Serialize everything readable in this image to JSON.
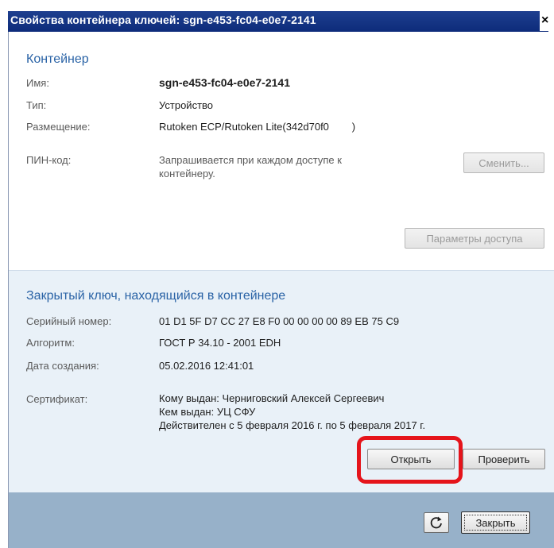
{
  "window": {
    "title": "Свойства контейнера ключей: sgn-e453-fc04-e0e7-2141",
    "close_glyph": "×"
  },
  "container": {
    "heading": "Контейнер",
    "name_label": "Имя:",
    "name_value": "sgn-e453-fc04-e0e7-2141",
    "type_label": "Тип:",
    "type_value": "Устройство",
    "placement_label": "Размещение:",
    "placement_value": "Rutoken ECP/Rutoken Lite(342d70f0        )",
    "pin_label": "ПИН-код:",
    "pin_value_line1": "Запрашивается при каждом доступе к",
    "pin_value_line2": "контейнеру.",
    "change_button": "Сменить...",
    "access_params_button": "Параметры доступа"
  },
  "private_key": {
    "heading": "Закрытый ключ, находящийся в контейнере",
    "serial_label": "Серийный номер:",
    "serial_value": "01 D1 5F D7 CC 27 E8 F0 00 00 00 00 89 EB 75 C9",
    "algorithm_label": "Алгоритм:",
    "algorithm_value": "ГОСТ Р 34.10 - 2001 EDH",
    "created_label": "Дата создания:",
    "created_value": "05.02.2016 12:41:01",
    "certificate_label": "Сертификат:",
    "issued_to": "Кому выдан: Черниговский Алексей Сергеевич",
    "issued_by": "Кем выдан: УЦ СФУ",
    "validity": "Действителен с 5 февраля 2016 г. по 5 февраля 2017 г.",
    "open_button": "Открыть",
    "verify_button": "Проверить"
  },
  "footer": {
    "refresh_icon": "refresh-icon",
    "close_button": "Закрыть"
  },
  "colors": {
    "title_bar": "#1e3f8f",
    "heading": "#2a63a6",
    "mid_section_bg": "#e9f1f8",
    "footer_bg": "#97b1c9",
    "highlight": "#e5141b"
  }
}
